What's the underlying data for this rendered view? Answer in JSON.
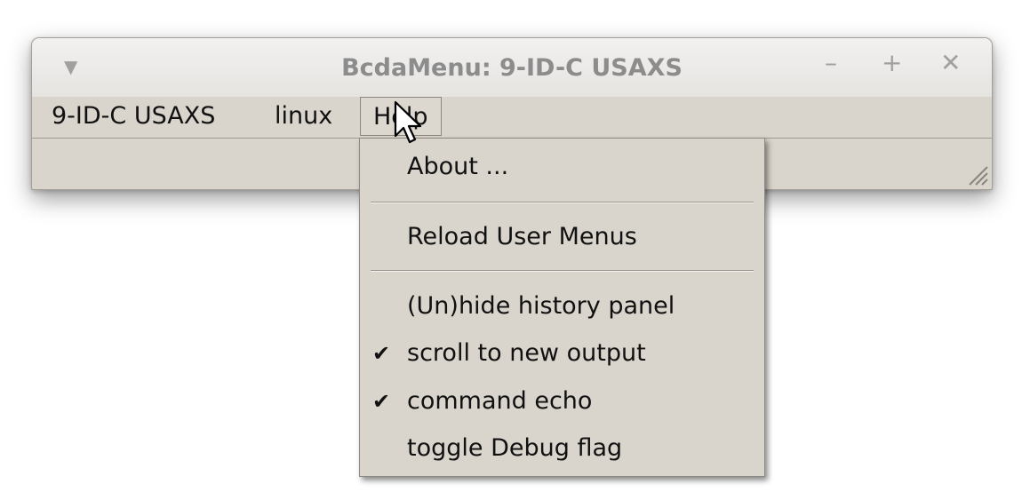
{
  "window": {
    "title": "BcdaMenu: 9-ID-C USAXS",
    "titlebar_icons": {
      "menu": "triangle-down-icon",
      "minimize": "minimize-icon",
      "maximize": "maximize-icon",
      "close": "close-icon"
    },
    "minimize_glyph": "–",
    "maximize_glyph": "+",
    "close_glyph": "✕",
    "menu_glyph": "▼"
  },
  "menubar": {
    "items": [
      {
        "label": "9-ID-C USAXS"
      },
      {
        "label": "linux"
      },
      {
        "label": "Help",
        "active": true
      }
    ]
  },
  "help_menu": {
    "items": [
      {
        "label": "About ...",
        "checked": false
      },
      {
        "label": "Reload User Menus",
        "checked": false
      },
      {
        "label": "(Un)hide history panel",
        "checked": false
      },
      {
        "label": "scroll to new output",
        "checked": true
      },
      {
        "label": "command echo",
        "checked": true
      },
      {
        "label": "toggle Debug flag",
        "checked": false
      }
    ],
    "check_glyph": "✔"
  },
  "colors": {
    "window_bg": "#d9d4cc",
    "title_text": "#8c8c8c",
    "menu_text": "#111111"
  }
}
